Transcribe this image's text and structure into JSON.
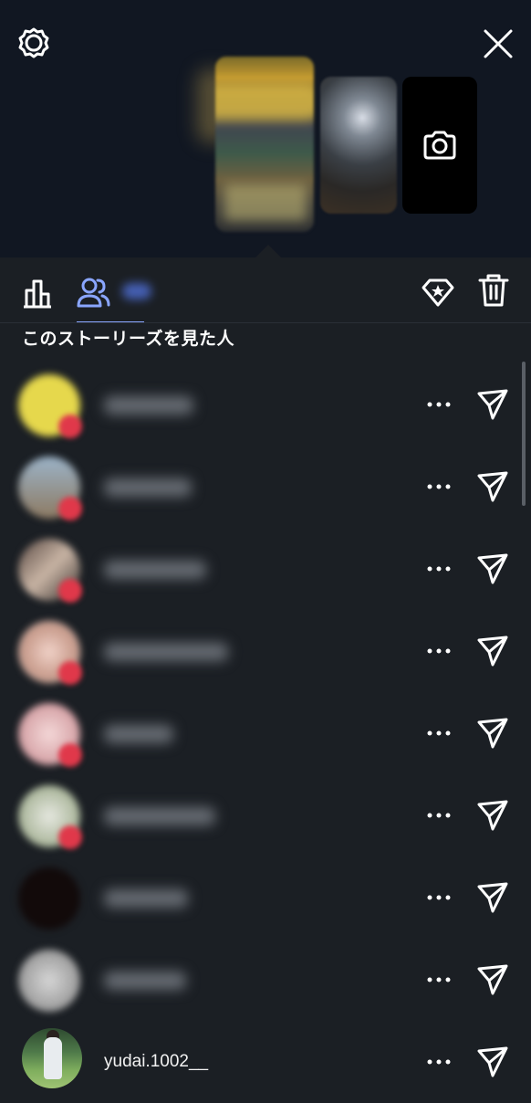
{
  "header": {
    "settings_icon": "gear-icon",
    "close_icon": "close-icon",
    "camera_icon": "camera-icon"
  },
  "tabs": {
    "insights_icon": "bar-chart-icon",
    "viewers_icon": "people-icon",
    "highlight_icon": "highlight-star-icon",
    "delete_icon": "trash-icon",
    "active_color": "#8aa6ff"
  },
  "viewers": {
    "title": "このストーリーズを見た人",
    "rows": [
      {
        "username": "",
        "blurred": true
      },
      {
        "username": "",
        "blurred": true
      },
      {
        "username": "",
        "blurred": true
      },
      {
        "username": "",
        "blurred": true
      },
      {
        "username": "",
        "blurred": true
      },
      {
        "username": "",
        "blurred": true
      },
      {
        "username": "",
        "blurred": true
      },
      {
        "username": "",
        "blurred": true
      },
      {
        "username": "yudai.1002__",
        "blurred": false
      }
    ],
    "more_icon": "more-horizontal-icon",
    "send_icon": "send-icon"
  },
  "colors": {
    "background": "#1b1f24",
    "header_background": "#111722",
    "like_badge": "#e0384a"
  }
}
